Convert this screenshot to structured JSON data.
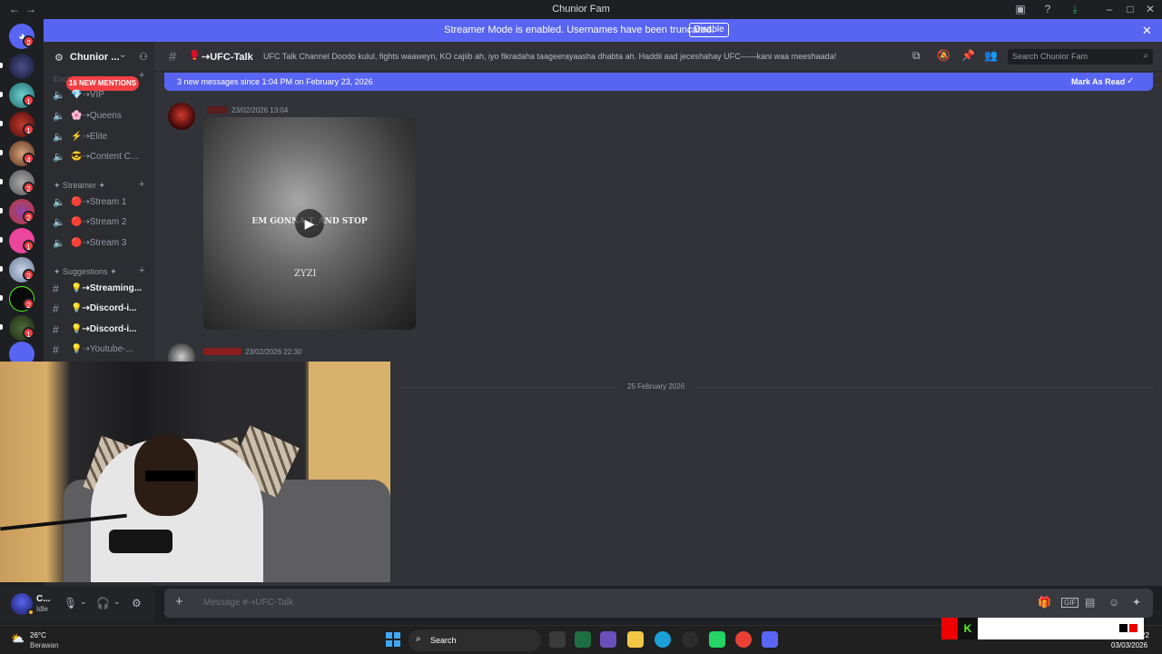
{
  "window": {
    "title": "Chunior Fam"
  },
  "banner": {
    "text": "Streamer Mode is enabled. Usernames have been truncated.",
    "button": "Disable"
  },
  "server": {
    "name": "Chunior ...",
    "mentions_pill": "16 NEW MENTIONS"
  },
  "rail_badges": [
    "2",
    "",
    "1",
    "1",
    "4",
    "2",
    "2",
    "1",
    "2",
    "2",
    "1",
    "1"
  ],
  "sidebar": {
    "cat_exclusive": "Exclusive VIP",
    "channels_top": [
      {
        "label": "⇢VIP",
        "emoji": "💎"
      },
      {
        "label": "⇢Queens",
        "emoji": "🌸"
      },
      {
        "label": "⇢Elite",
        "emoji": "⚡"
      },
      {
        "label": "⇢Content C...",
        "emoji": "😎"
      }
    ],
    "cat_streamer": "✦ Streamer ✦",
    "channels_streamer": [
      {
        "label": "⇢Stream 1",
        "emoji": "🔴"
      },
      {
        "label": "⇢Stream 2",
        "emoji": "🔴"
      },
      {
        "label": "⇢Stream 3",
        "emoji": "🔴"
      }
    ],
    "cat_suggestions": "✦ Suggestions ✦",
    "channels_suggestions": [
      {
        "label": "⇢Streaming...",
        "emoji": "💡"
      },
      {
        "label": "⇢Discord-i...",
        "emoji": "💡"
      },
      {
        "label": "⇢Discord-i...",
        "emoji": "💡"
      },
      {
        "label": "⇢Youtube-...",
        "emoji": "💡"
      }
    ]
  },
  "header": {
    "channel": "⇢UFC-Talk",
    "topic": "UFC Talk Channel Doodo kulul, fights waaweyn, KO cajiib ah, iyo fikradaha taageerayaasha dhabta ah. Haddii aad jeceshahay UFC——kani waa meeshaada!",
    "search_placeholder": "Search Chunior Fam"
  },
  "newbar": {
    "text": "3 new messages since 1:04 PM on February 23, 2026",
    "action": "Mark As Read"
  },
  "messages": [
    {
      "timestamp": "23/02/2026 13:04",
      "video_caption": "EM GONNA T_AND STOP",
      "watermark": "ZYZI"
    },
    {
      "timestamp": "23/02/2026 22:30"
    }
  ],
  "date_divider": "25 February 2026",
  "composer": {
    "placeholder": "Message #⇢UFC-Talk"
  },
  "user": {
    "name": "C...",
    "status": "Idle"
  },
  "taskbar": {
    "temp": "26°C",
    "weather": "Berawan",
    "search": "Search",
    "date": "03/03/2026",
    "time_partial": "22"
  },
  "colors": {
    "accent": "#5865f2",
    "badge": "#f23f43"
  }
}
